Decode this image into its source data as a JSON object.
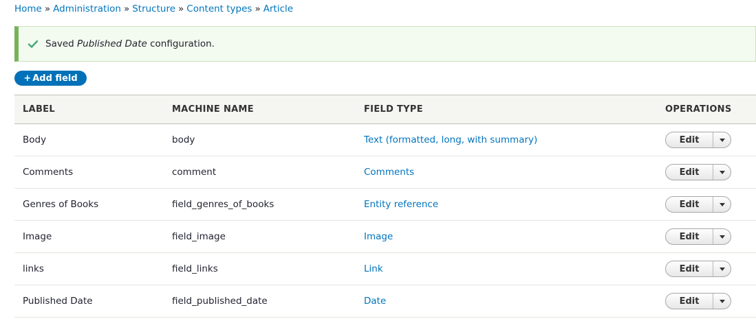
{
  "breadcrumb": {
    "items": [
      "Home",
      "Administration",
      "Structure",
      "Content types",
      "Article"
    ],
    "separator": "»"
  },
  "status": {
    "prefix": "Saved ",
    "emphasis": "Published Date",
    "suffix": " configuration.",
    "color": "#77b259"
  },
  "add_field_button": {
    "label": "Add field",
    "icon": "plus-icon"
  },
  "table": {
    "headers": {
      "label": "LABEL",
      "machine_name": "MACHINE NAME",
      "field_type": "FIELD TYPE",
      "operations": "OPERATIONS"
    },
    "rows": [
      {
        "label": "Body",
        "machine_name": "body",
        "field_type": "Text (formatted, long, with summary)",
        "operation": "Edit"
      },
      {
        "label": "Comments",
        "machine_name": "comment",
        "field_type": "Comments",
        "operation": "Edit"
      },
      {
        "label": "Genres of Books",
        "machine_name": "field_genres_of_books",
        "field_type": "Entity reference",
        "operation": "Edit"
      },
      {
        "label": "Image",
        "machine_name": "field_image",
        "field_type": "Image",
        "operation": "Edit"
      },
      {
        "label": "links",
        "machine_name": "field_links",
        "field_type": "Link",
        "operation": "Edit"
      },
      {
        "label": "Published Date",
        "machine_name": "field_published_date",
        "field_type": "Date",
        "operation": "Edit"
      }
    ]
  },
  "colors": {
    "link": "#0074bd",
    "primary_button": "#0071b8"
  }
}
